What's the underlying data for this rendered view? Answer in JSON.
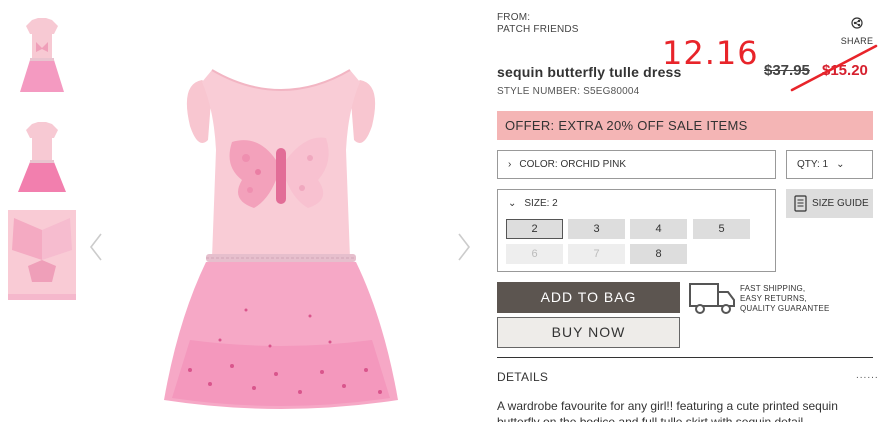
{
  "product": {
    "from_label": "FROM:",
    "brand": "PATCH FRIENDS",
    "title": "sequin butterfly tulle dress",
    "style_number": "STYLE NUMBER: S5EG80004",
    "price_original": "$37.95",
    "price_sale": "$15.20",
    "price_annotation": "12.16",
    "share_label": "SHARE"
  },
  "offer_banner": "OFFER: EXTRA 20% OFF SALE ITEMS",
  "color_select": {
    "label": "COLOR: ORCHID PINK",
    "chevron": "›"
  },
  "qty_select": {
    "label": "QTY: 1",
    "chevron": "⌄"
  },
  "size_select": {
    "label": "SIZE: 2",
    "chevron": "⌄",
    "sizes": [
      {
        "label": "2",
        "state": "selected"
      },
      {
        "label": "3",
        "state": "available"
      },
      {
        "label": "4",
        "state": "available"
      },
      {
        "label": "5",
        "state": "available"
      },
      {
        "label": "6",
        "state": "disabled"
      },
      {
        "label": "7",
        "state": "disabled"
      },
      {
        "label": "8",
        "state": "available"
      }
    ]
  },
  "size_guide_label": "SIZE GUIDE",
  "add_to_bag_label": "ADD TO BAG",
  "buy_now_label": "BUY NOW",
  "shipping_lines": [
    "FAST SHIPPING,",
    "EASY RETURNS,",
    "QUALITY GUARANTEE"
  ],
  "details": {
    "heading": "DETAILS",
    "more": "......",
    "description": "A wardrobe favourite for any girl!! featuring a cute printed sequin butterfly on the bodice and full tulle skirt with sequin detail."
  },
  "colors": {
    "offer_bg": "#f4b5b5",
    "sale_red": "#d6202e",
    "annotation_red": "#e8242a",
    "primary_btn": "#5c5550",
    "dress_pink": "#f7c9d3",
    "tutu_pink": "#f49ac1"
  },
  "icons": [
    "share-icon",
    "truck-icon",
    "size-guide-icon",
    "chevron-left-icon",
    "chevron-right-icon"
  ]
}
